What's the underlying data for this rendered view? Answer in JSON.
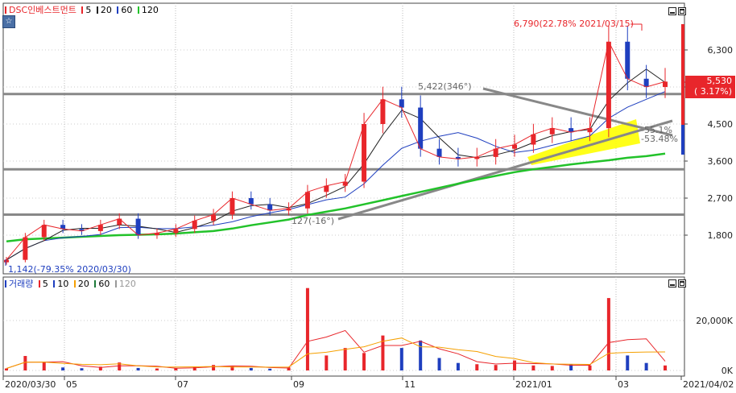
{
  "price_panel": {
    "legend_name": "DSC인베스트먼트",
    "ma_labels": [
      {
        "label": "5",
        "color": "#e8262b"
      },
      {
        "label": "20",
        "color": "#222222"
      },
      {
        "label": "60",
        "color": "#1f3fbf"
      },
      {
        "label": "120",
        "color": "#22c22a"
      }
    ],
    "y_ticks": [
      "6,300",
      "5,400",
      "4,500",
      "3,600",
      "2,700",
      "1,800"
    ],
    "current_price": "5,530",
    "current_change": "( 3.17%)",
    "high_annotation": "6,790(22.78% 2021/03/15)",
    "low_annotation": "1,142(-79.35% 2020/03/30)",
    "pattern_label": "5,422(346°)",
    "label_127": "127(-16°)",
    "label_55": "-55.1%",
    "label_53": "-53.48%"
  },
  "volume_panel": {
    "legend_name": "거래량",
    "ma_labels": [
      {
        "label": "5",
        "color": "#e8262b"
      },
      {
        "label": "10",
        "color": "#1f3fbf"
      },
      {
        "label": "20",
        "color": "#f5a000"
      },
      {
        "label": "60",
        "color": "#1e7a3a"
      },
      {
        "label": "120",
        "color": "#999999"
      }
    ],
    "y_ticks": [
      "20,000K",
      "0K"
    ]
  },
  "x_axis": {
    "labels": [
      "2020/03/30",
      "05",
      "07",
      "09",
      "11",
      "2021/01",
      "03",
      "2021/04/02"
    ]
  },
  "colors": {
    "up": "#e8262b",
    "down": "#1f3fbf",
    "ma5": "#e8262b",
    "ma20": "#222222",
    "ma60": "#1f3fbf",
    "ma120": "#22c22a",
    "support_lines": "#888888",
    "triangle_fill": "#ffff00"
  },
  "chart_data": [
    {
      "type": "candlestick",
      "title": "DSC인베스트먼트",
      "x_range": [
        "2020/03/30",
        "2021/04/02"
      ],
      "ylim": [
        1100,
        7100
      ],
      "horizontal_levels": [
        5230,
        3400,
        2300
      ],
      "series": [
        {
          "name": "5",
          "type": "line"
        },
        {
          "name": "20",
          "type": "line"
        },
        {
          "name": "60",
          "type": "line"
        },
        {
          "name": "120",
          "type": "line"
        }
      ],
      "annotations": {
        "high": {
          "date": "2021/03/15",
          "value": 6790,
          "pct": 22.78
        },
        "low": {
          "date": "2020/03/30",
          "value": 1142,
          "pct": -79.35
        },
        "last": {
          "date": "2021/04/02",
          "value": 5530,
          "pct": 3.17
        }
      },
      "x": [
        "2020/03/30",
        "2020/04/13",
        "2020/04/27",
        "2020/05/11",
        "2020/05/25",
        "2020/06/08",
        "2020/06/22",
        "2020/07/06",
        "2020/07/20",
        "2020/08/03",
        "2020/08/17",
        "2020/08/31",
        "2020/09/14",
        "2020/09/28",
        "2020/10/12",
        "2020/10/26",
        "2020/11/09",
        "2020/11/23",
        "2020/12/07",
        "2020/12/14",
        "2020/12/21",
        "2020/12/28",
        "2021/01/04",
        "2021/01/11",
        "2021/01/18",
        "2021/01/25",
        "2021/02/01",
        "2021/02/08",
        "2021/02/15",
        "2021/02/22",
        "2021/03/02",
        "2021/03/08",
        "2021/03/15",
        "2021/03/22",
        "2021/03/29",
        "2021/04/02"
      ],
      "close": [
        1200,
        1750,
        2050,
        1950,
        1900,
        2050,
        2200,
        1800,
        1850,
        1950,
        2150,
        2300,
        2700,
        2550,
        2400,
        2450,
        2850,
        3000,
        3100,
        4500,
        5100,
        4900,
        3900,
        3700,
        3650,
        3700,
        3900,
        4000,
        4250,
        4400,
        4300,
        4400,
        6500,
        5600,
        5400,
        5530
      ],
      "ma120": [
        1650,
        1700,
        1720,
        1740,
        1760,
        1780,
        1800,
        1810,
        1820,
        1840,
        1870,
        1900,
        1960,
        2040,
        2110,
        2180,
        2290,
        2370,
        2450,
        2550,
        2650,
        2750,
        2850,
        2950,
        3050,
        3150,
        3240,
        3330,
        3400,
        3460,
        3520,
        3570,
        3620,
        3680,
        3720,
        3780
      ]
    },
    {
      "type": "bar",
      "title": "거래량",
      "ylabel": "",
      "ylim": [
        0,
        36000
      ],
      "unit": "K",
      "x": [
        "2020/03/30",
        "2020/04/13",
        "2020/04/27",
        "2020/05/11",
        "2020/05/25",
        "2020/06/08",
        "2020/06/22",
        "2020/07/06",
        "2020/07/20",
        "2020/08/03",
        "2020/08/17",
        "2020/08/31",
        "2020/09/14",
        "2020/09/28",
        "2020/10/12",
        "2020/10/26",
        "2020/11/09",
        "2020/11/23",
        "2020/12/07",
        "2020/12/14",
        "2020/12/21",
        "2020/12/28",
        "2021/01/04",
        "2021/01/11",
        "2021/01/18",
        "2021/01/25",
        "2021/02/01",
        "2021/02/08",
        "2021/02/15",
        "2021/02/22",
        "2021/03/02",
        "2021/03/08",
        "2021/03/15",
        "2021/03/22",
        "2021/03/29",
        "2021/04/02"
      ],
      "values": [
        800,
        5800,
        3500,
        1200,
        900,
        1500,
        3200,
        1000,
        800,
        900,
        1400,
        2200,
        1800,
        1000,
        700,
        1200,
        33000,
        6000,
        9000,
        7000,
        14000,
        9000,
        12000,
        5000,
        3000,
        2500,
        2200,
        4000,
        2000,
        1800,
        2500,
        2000,
        29000,
        6000,
        3000,
        2000
      ]
    }
  ]
}
